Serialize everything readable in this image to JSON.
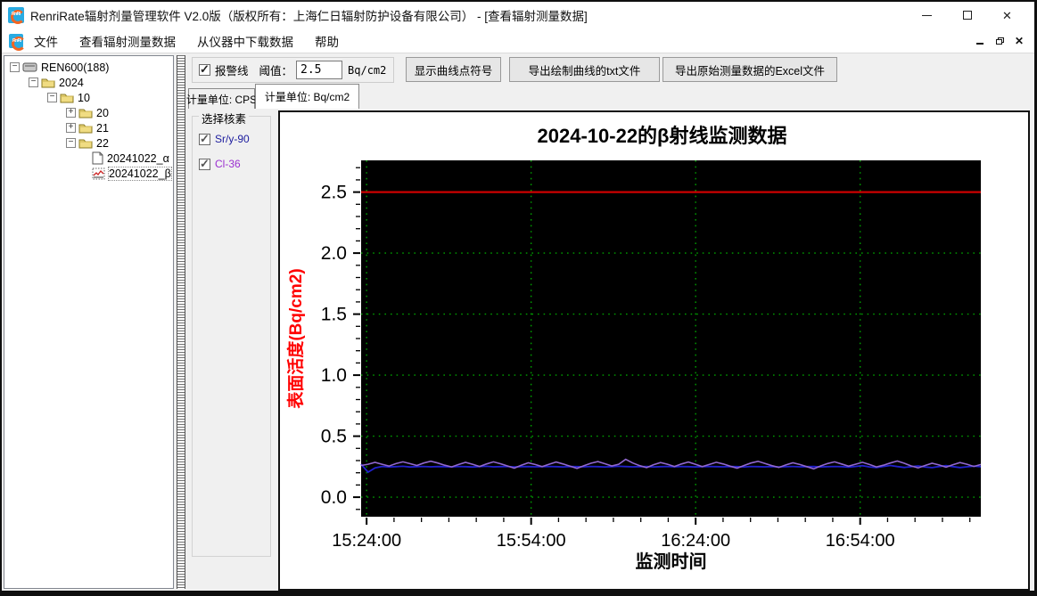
{
  "window": {
    "title": "RenriRate辐射剂量管理软件 V2.0版（版权所有：上海仁日辐射防护设备有限公司） - [查看辐射测量数据]"
  },
  "menu": {
    "items": [
      "文件",
      "查看辐射测量数据",
      "从仪器中下载数据",
      "帮助"
    ]
  },
  "tree": {
    "items": [
      {
        "label": "REN600(188)",
        "expander": "minus",
        "icon": "device"
      },
      {
        "label": "2024",
        "expander": "minus",
        "icon": "folder"
      },
      {
        "label": "10",
        "expander": "minus",
        "icon": "folder"
      },
      {
        "label": "20",
        "expander": "plus",
        "icon": "folder"
      },
      {
        "label": "21",
        "expander": "plus",
        "icon": "folder"
      },
      {
        "label": "22",
        "expander": "minus",
        "icon": "folder"
      },
      {
        "label": "20241022_α",
        "expander": "none",
        "icon": "file"
      },
      {
        "label": "20241022_β",
        "expander": "none",
        "icon": "chart-file"
      }
    ]
  },
  "toolbar": {
    "alarm_label": "报警线",
    "alarm_checked": true,
    "threshold_label": "阈值：",
    "threshold_value": "2.5",
    "threshold_unit": "Bq/cm2",
    "btn_show_points": "显示曲线点符号",
    "btn_export_txt": "导出绘制曲线的txt文件",
    "btn_export_excel": "导出原始测量数据的Excel文件"
  },
  "tabs": [
    {
      "label": "计量单位: CPS",
      "active": false
    },
    {
      "label": "计量单位: Bq/cm2",
      "active": true
    }
  ],
  "nuclides": {
    "group_label": "选择核素",
    "items": [
      {
        "label": "Sr/y-90",
        "checked": true,
        "color": "#1c1c9e"
      },
      {
        "label": "Cl-36",
        "checked": true,
        "color": "#9b30d0"
      }
    ]
  },
  "chart_data": {
    "type": "line",
    "title": "2024-10-22的β射线监测数据",
    "xlabel": "监测时间",
    "ylabel": "表面活度(Bq/cm2)",
    "plot_bg": "#000000",
    "grid_color": "#00a000",
    "grid_on": true,
    "x_range": [
      "15:23:00",
      "17:16:00"
    ],
    "y_range": [
      -0.16,
      2.76
    ],
    "y_ticks": [
      0.0,
      0.5,
      1.0,
      1.5,
      2.0,
      2.5
    ],
    "y_minor_step": 0.1,
    "x_ticks": [
      "15:24:00",
      "15:54:00",
      "16:24:00",
      "16:54:00"
    ],
    "x_minor_step_minutes": 5,
    "alarm_line": {
      "value": 2.5,
      "color": "#cc0000"
    },
    "series": [
      {
        "name": "Sr/y-90",
        "color": "#2121cd",
        "values": [
          0.27,
          0.205,
          0.24,
          0.252,
          0.248,
          0.25,
          0.253,
          0.247,
          0.25,
          0.252,
          0.249,
          0.251,
          0.25,
          0.248,
          0.252,
          0.25,
          0.247,
          0.251,
          0.253,
          0.249,
          0.25,
          0.252,
          0.248,
          0.25,
          0.251,
          0.249,
          0.25,
          0.252,
          0.25,
          0.248,
          0.251,
          0.25,
          0.249,
          0.252,
          0.25,
          0.248,
          0.25,
          0.253,
          0.251,
          0.249,
          0.25,
          0.251,
          0.248,
          0.25,
          0.252,
          0.249,
          0.251,
          0.25,
          0.248,
          0.25,
          0.252,
          0.25,
          0.249,
          0.251,
          0.25,
          0.248,
          0.252,
          0.25,
          0.249,
          0.251,
          0.248,
          0.25,
          0.252,
          0.249,
          0.25,
          0.251,
          0.248,
          0.25,
          0.252,
          0.25,
          0.246,
          0.252,
          0.258,
          0.248,
          0.242,
          0.252,
          0.26,
          0.251,
          0.244,
          0.25,
          0.256,
          0.247,
          0.242,
          0.251,
          0.258,
          0.25,
          0.243,
          0.249,
          0.255,
          0.25
        ]
      },
      {
        "name": "Cl-36",
        "color": "#9168cf",
        "values": [
          0.26,
          0.27,
          0.285,
          0.27,
          0.255,
          0.275,
          0.29,
          0.275,
          0.26,
          0.28,
          0.295,
          0.28,
          0.262,
          0.248,
          0.268,
          0.285,
          0.27,
          0.252,
          0.272,
          0.29,
          0.274,
          0.256,
          0.238,
          0.262,
          0.282,
          0.268,
          0.25,
          0.27,
          0.288,
          0.272,
          0.254,
          0.236,
          0.258,
          0.278,
          0.292,
          0.274,
          0.256,
          0.27,
          0.31,
          0.28,
          0.258,
          0.242,
          0.266,
          0.284,
          0.27,
          0.252,
          0.272,
          0.288,
          0.27,
          0.25,
          0.268,
          0.286,
          0.272,
          0.254,
          0.238,
          0.26,
          0.28,
          0.294,
          0.276,
          0.258,
          0.244,
          0.264,
          0.282,
          0.268,
          0.25,
          0.232,
          0.256,
          0.276,
          0.29,
          0.272,
          0.254,
          0.27,
          0.286,
          0.268,
          0.248,
          0.262,
          0.28,
          0.296,
          0.278,
          0.256,
          0.24,
          0.26,
          0.278,
          0.264,
          0.246,
          0.266,
          0.284,
          0.27,
          0.252,
          0.268
        ]
      }
    ]
  }
}
